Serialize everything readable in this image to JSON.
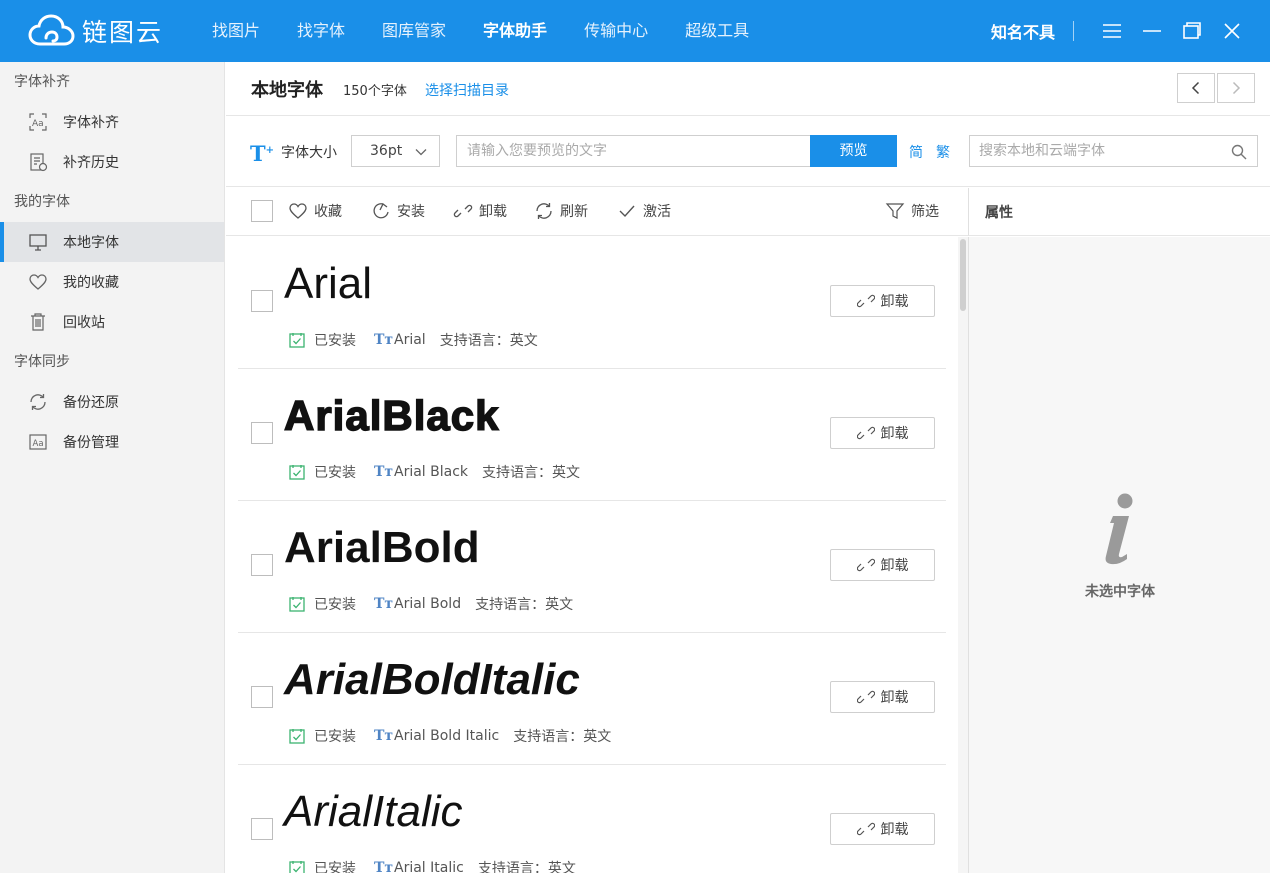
{
  "app": {
    "logo_text": "链图云",
    "brand_color": "#1a8fe8"
  },
  "nav": {
    "items": [
      {
        "label": "找图片",
        "active": false
      },
      {
        "label": "找字体",
        "active": false
      },
      {
        "label": "图库管家",
        "active": false
      },
      {
        "label": "字体助手",
        "active": true
      },
      {
        "label": "传输中心",
        "active": false
      },
      {
        "label": "超级工具",
        "active": false
      }
    ]
  },
  "user": {
    "name": "知名不具"
  },
  "sidebar": {
    "sections": [
      {
        "title": "字体补齐",
        "items": [
          {
            "label": "字体补齐",
            "icon": "font-aa-icon"
          },
          {
            "label": "补齐历史",
            "icon": "history-doc-icon"
          }
        ]
      },
      {
        "title": "我的字体",
        "items": [
          {
            "label": "本地字体",
            "icon": "monitor-icon",
            "active": true
          },
          {
            "label": "我的收藏",
            "icon": "heart-icon"
          },
          {
            "label": "回收站",
            "icon": "trash-icon"
          }
        ]
      },
      {
        "title": "字体同步",
        "items": [
          {
            "label": "备份还原",
            "icon": "sync-icon"
          },
          {
            "label": "备份管理",
            "icon": "aa-box-icon"
          }
        ]
      }
    ]
  },
  "header": {
    "title": "本地字体",
    "count": "150个字体",
    "scan_link": "选择扫描目录"
  },
  "toolbar": {
    "font_size_label": "字体大小",
    "font_size_value": "36pt",
    "preview_placeholder": "请输入您要预览的文字",
    "preview_button": "预览",
    "simplified": "简",
    "traditional": "繁",
    "search_placeholder": "搜索本地和云端字体"
  },
  "actions": {
    "favorite": "收藏",
    "install": "安装",
    "uninstall": "卸载",
    "refresh": "刷新",
    "activate": "激活",
    "filter": "筛选"
  },
  "properties": {
    "title": "属性",
    "empty_text": "未选中字体"
  },
  "fonts": [
    {
      "display": "Arial",
      "status": "已安装",
      "family": "Arial",
      "lang": "支持语言：英文",
      "button": "卸载"
    },
    {
      "display": "ArialBlack",
      "status": "已安装",
      "family": "Arial Black",
      "lang": "支持语言：英文",
      "button": "卸载"
    },
    {
      "display": "ArialBold",
      "status": "已安装",
      "family": "Arial Bold",
      "lang": "支持语言：英文",
      "button": "卸载"
    },
    {
      "display": "ArialBoldItalic",
      "status": "已安装",
      "family": "Arial Bold Italic",
      "lang": "支持语言：英文",
      "button": "卸载"
    },
    {
      "display": "ArialItalic",
      "status": "已安装",
      "family": "Arial Italic",
      "lang": "支持语言：英文",
      "button": "卸载"
    }
  ]
}
